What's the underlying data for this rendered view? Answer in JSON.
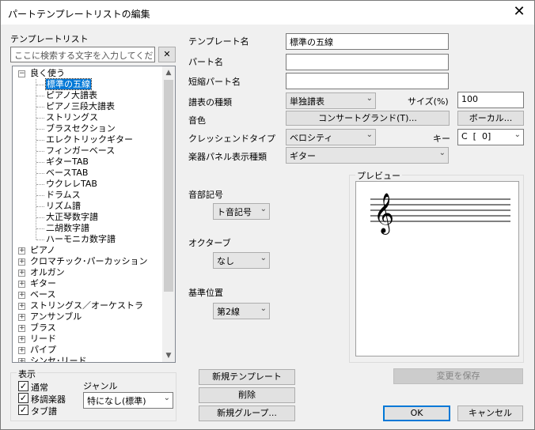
{
  "window": {
    "title": "パートテンプレートリストの編集",
    "close": "✕"
  },
  "left": {
    "list_title": "テンプレートリスト",
    "search": {
      "placeholder": "ここに検索する文字を入力してください",
      "clear": "✕"
    },
    "tree": {
      "group_open": "良く使う",
      "children": [
        "標準の五線",
        "ピアノ大譜表",
        "ピアノ三段大譜表",
        "ストリングス",
        "ブラスセクション",
        "エレクトリックギター",
        "フィンガーベース",
        "ギターTAB",
        "ベースTAB",
        "ウクレレTAB",
        "ドラムス",
        "リズム譜",
        "大正琴数字譜",
        "二胡数字譜",
        "ハーモニカ数字譜"
      ],
      "groups": [
        "ピアノ",
        "クロマチック･パーカッション",
        "オルガン",
        "ギター",
        "ベース",
        "ストリングス／オーケストラ",
        "アンサンブル",
        "ブラス",
        "リード",
        "パイプ",
        "シンセ･リード"
      ]
    },
    "display": {
      "legend": "表示",
      "checks": [
        {
          "label": "通常",
          "checked": true
        },
        {
          "label": "移調楽器",
          "checked": true
        },
        {
          "label": "タブ譜",
          "checked": true
        }
      ],
      "genre_label": "ジャンル",
      "genre_value": "特になし(標準)"
    }
  },
  "form": {
    "template_name_label": "テンプレート名",
    "template_name_value": "標準の五線",
    "part_name_label": "パート名",
    "part_name_value": "",
    "short_name_label": "短縮パート名",
    "short_name_value": "",
    "staff_type_label": "譜表の種類",
    "staff_type_value": "単独譜表",
    "size_label": "サイズ(%)",
    "size_value": "100",
    "tone_label": "音色",
    "tone_button": "コンサートグランド(T)...",
    "vocal_button": "ボーカル...",
    "crescendo_label": "クレッシェンドタイプ",
    "crescendo_value": "ベロシティ",
    "key_label": "キー",
    "key_value": "C  [  0]",
    "panel_label": "楽器パネル表示種類",
    "panel_value": "ギター",
    "clef_label": "音部記号",
    "clef_value": "ト音記号",
    "octave_label": "オクターブ",
    "octave_value": "なし",
    "ref_label": "基準位置",
    "ref_value": "第2線",
    "preview_label": "プレビュー"
  },
  "buttons": {
    "new_template": "新規テンプレート",
    "delete": "削除",
    "new_group": "新規グループ...",
    "save_changes": "変更を保存",
    "ok": "OK",
    "cancel": "キャンセル"
  },
  "icons": {
    "dropdown": "chevron-down-icon",
    "treble_clef": "𝄞"
  }
}
